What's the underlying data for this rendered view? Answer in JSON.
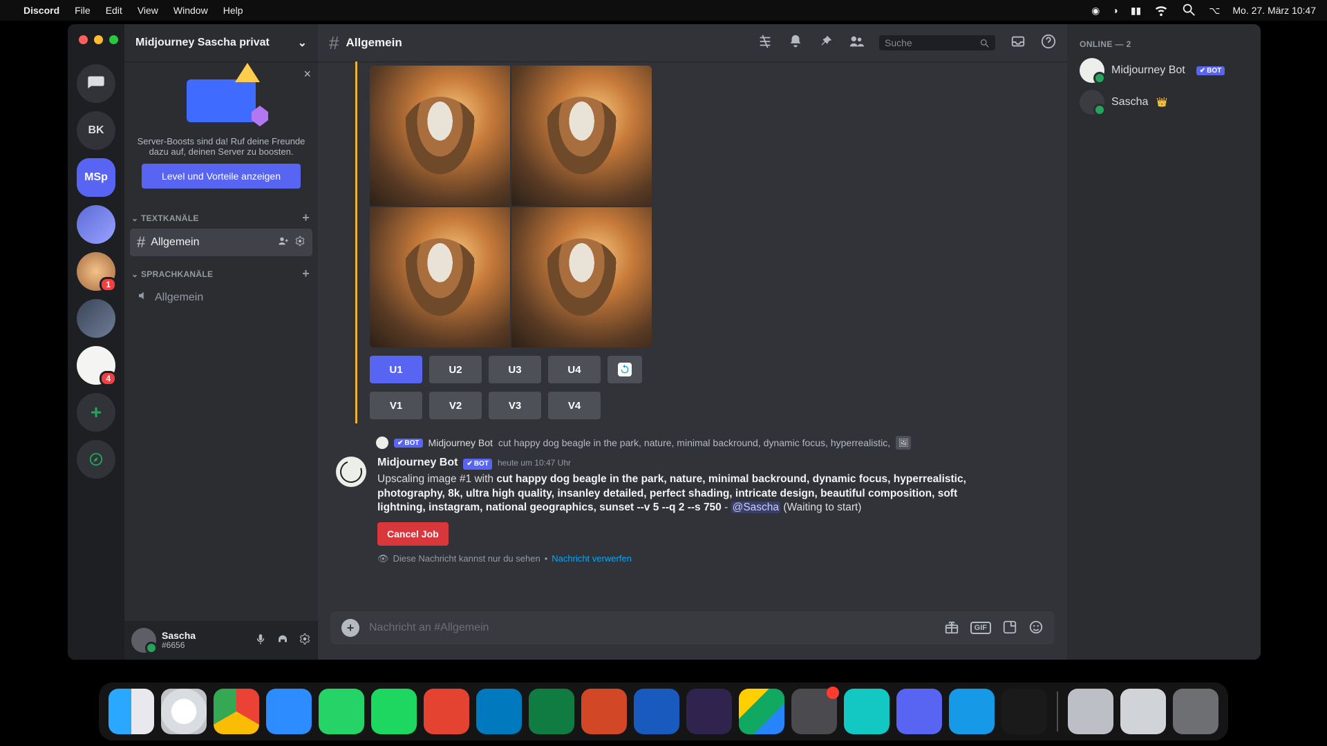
{
  "menubar": {
    "app_name": "Discord",
    "items": [
      "File",
      "Edit",
      "View",
      "Window",
      "Help"
    ],
    "date_time": "Mo. 27. März  10:47"
  },
  "server_rail": {
    "items": [
      {
        "id": "dm",
        "kind": "dm"
      },
      {
        "id": "bk",
        "kind": "text",
        "label": "BK"
      },
      {
        "id": "msp",
        "kind": "text",
        "label": "MSp",
        "active": true
      },
      {
        "id": "s3",
        "kind": "img"
      },
      {
        "id": "s4",
        "kind": "img",
        "badge": "1"
      },
      {
        "id": "s5",
        "kind": "img"
      },
      {
        "id": "s6",
        "kind": "img",
        "badge": "4"
      },
      {
        "id": "add",
        "kind": "add"
      },
      {
        "id": "explore",
        "kind": "explore"
      }
    ]
  },
  "sidebar": {
    "server_name": "Midjourney Sascha privat",
    "boost": {
      "text": "Server-Boosts sind da! Ruf deine Freunde dazu auf, deinen Server zu boosten.",
      "cta": "Level und Vorteile anzeigen"
    },
    "cat_text": "TEXTKANÄLE",
    "cat_voice": "SPRACHKANÄLE",
    "text_channel": "Allgemein",
    "voice_channel": "Allgemein"
  },
  "user_panel": {
    "name": "Sascha",
    "tag": "#6656"
  },
  "header": {
    "channel": "Allgemein",
    "search_placeholder": "Suche"
  },
  "mj_buttons": {
    "u": [
      "U1",
      "U2",
      "U3",
      "U4"
    ],
    "v": [
      "V1",
      "V2",
      "V3",
      "V4"
    ]
  },
  "reply": {
    "author": "Midjourney Bot",
    "snippet": "cut happy dog beagle in the park, nature, minimal backround, dynamic focus, hyperrealistic,"
  },
  "message": {
    "author": "Midjourney Bot",
    "bot_tag": "BOT",
    "timestamp": "heute um 10:47 Uhr",
    "lead": "Upscaling image #1 with ",
    "prompt": "cut happy dog beagle in the park, nature, minimal backround, dynamic focus, hyperrealistic, photography, 8k, ultra high quality, insanley detailed, perfect shading, intricate design, beautiful composition, soft lightning, instagram, national geographics, sunset --v 5 --q 2 --s 750",
    "dash": " - ",
    "mention": "@Sascha",
    "status": " (Waiting to start)",
    "cancel": "Cancel Job",
    "ephemeral_text": "Diese Nachricht kannst nur du sehen",
    "ephemeral_sep": " • ",
    "ephemeral_link": "Nachricht verwerfen"
  },
  "composer": {
    "placeholder": "Nachricht an #Allgemein",
    "gif": "GIF"
  },
  "members": {
    "section": "ONLINE — 2",
    "list": [
      {
        "name": "Midjourney Bot",
        "bot": true
      },
      {
        "name": "Sascha",
        "owner": true
      }
    ]
  }
}
